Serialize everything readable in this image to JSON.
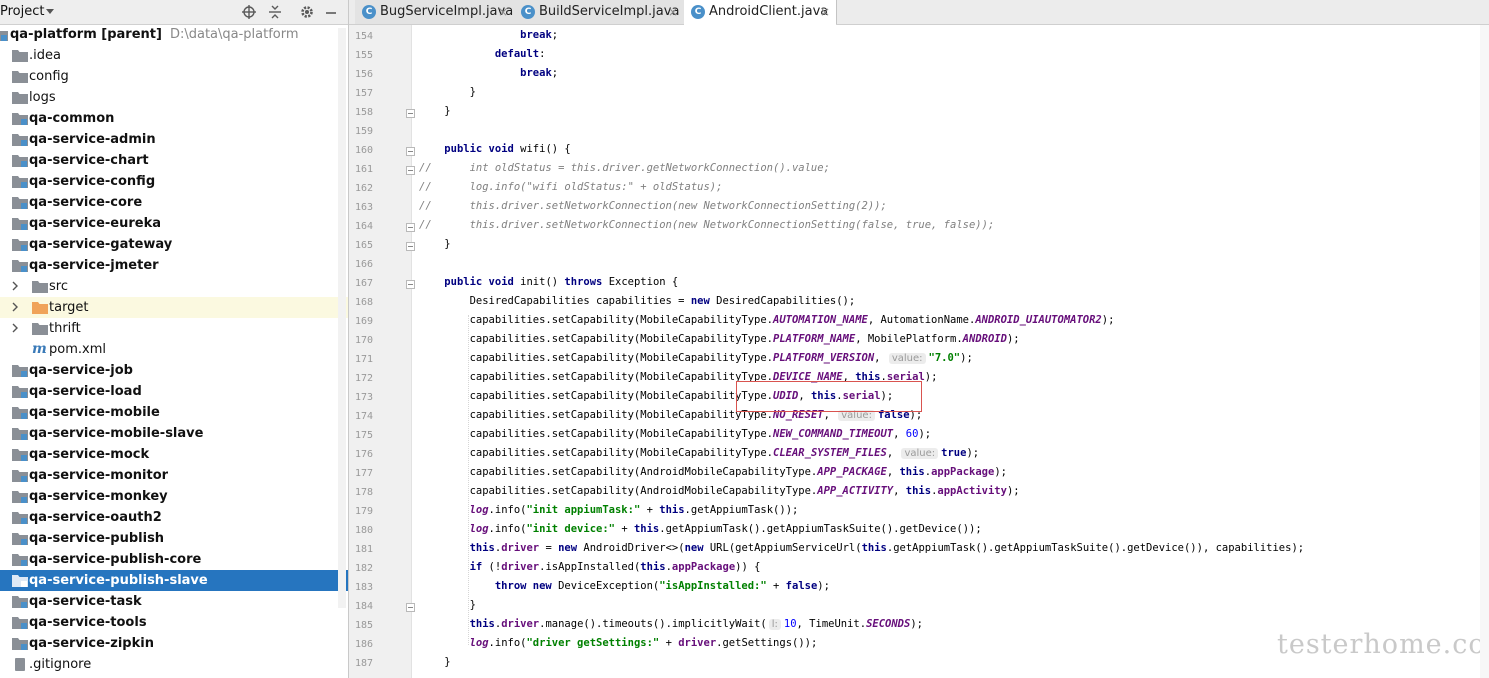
{
  "panel": {
    "title": "Project"
  },
  "tree": [
    {
      "label": "qa-platform [parent]",
      "path": "D:\\data\\qa-platform",
      "bold": true,
      "indent": 0,
      "icon": "module"
    },
    {
      "label": ".idea",
      "indent": 1,
      "icon": "folder"
    },
    {
      "label": "config",
      "indent": 1,
      "icon": "folder"
    },
    {
      "label": "logs",
      "indent": 1,
      "icon": "folder"
    },
    {
      "label": "qa-common",
      "bold": true,
      "indent": 1,
      "icon": "module"
    },
    {
      "label": "qa-service-admin",
      "bold": true,
      "indent": 1,
      "icon": "module"
    },
    {
      "label": "qa-service-chart",
      "bold": true,
      "indent": 1,
      "icon": "module"
    },
    {
      "label": "qa-service-config",
      "bold": true,
      "indent": 1,
      "icon": "module"
    },
    {
      "label": "qa-service-core",
      "bold": true,
      "indent": 1,
      "icon": "module"
    },
    {
      "label": "qa-service-eureka",
      "bold": true,
      "indent": 1,
      "icon": "module"
    },
    {
      "label": "qa-service-gateway",
      "bold": true,
      "indent": 1,
      "icon": "module"
    },
    {
      "label": "qa-service-jmeter",
      "bold": true,
      "indent": 1,
      "icon": "module",
      "expanded": true
    },
    {
      "label": "src",
      "indent": 2,
      "icon": "folder",
      "chevron": true
    },
    {
      "label": "target",
      "indent": 2,
      "icon": "folder-orange",
      "chevron": true,
      "excluded": true
    },
    {
      "label": "thrift",
      "indent": 2,
      "icon": "folder",
      "chevron": true
    },
    {
      "label": "pom.xml",
      "indent": 2,
      "icon": "pom"
    },
    {
      "label": "qa-service-job",
      "bold": true,
      "indent": 1,
      "icon": "module"
    },
    {
      "label": "qa-service-load",
      "bold": true,
      "indent": 1,
      "icon": "module"
    },
    {
      "label": "qa-service-mobile",
      "bold": true,
      "indent": 1,
      "icon": "module"
    },
    {
      "label": "qa-service-mobile-slave",
      "bold": true,
      "indent": 1,
      "icon": "module"
    },
    {
      "label": "qa-service-mock",
      "bold": true,
      "indent": 1,
      "icon": "module"
    },
    {
      "label": "qa-service-monitor",
      "bold": true,
      "indent": 1,
      "icon": "module"
    },
    {
      "label": "qa-service-monkey",
      "bold": true,
      "indent": 1,
      "icon": "module"
    },
    {
      "label": "qa-service-oauth2",
      "bold": true,
      "indent": 1,
      "icon": "module"
    },
    {
      "label": "qa-service-publish",
      "bold": true,
      "indent": 1,
      "icon": "module"
    },
    {
      "label": "qa-service-publish-core",
      "bold": true,
      "indent": 1,
      "icon": "module"
    },
    {
      "label": "qa-service-publish-slave",
      "bold": true,
      "indent": 1,
      "icon": "module",
      "selected": true
    },
    {
      "label": "qa-service-task",
      "bold": true,
      "indent": 1,
      "icon": "module"
    },
    {
      "label": "qa-service-tools",
      "bold": true,
      "indent": 1,
      "icon": "module"
    },
    {
      "label": "qa-service-zipkin",
      "bold": true,
      "indent": 1,
      "icon": "module"
    },
    {
      "label": ".gitignore",
      "indent": 1,
      "icon": "file"
    }
  ],
  "tabs": [
    {
      "label": "BugServiceImpl.java",
      "icon": "C",
      "active": false
    },
    {
      "label": "BuildServiceImpl.java",
      "icon": "C",
      "active": false
    },
    {
      "label": "AndroidClient.java",
      "icon": "C",
      "active": true
    }
  ],
  "close_glyph": "×",
  "lines": [
    {
      "n": "154",
      "tok": [
        [
          "                ",
          ""
        ],
        [
          "break",
          "kw"
        ],
        [
          ";",
          ""
        ]
      ]
    },
    {
      "n": "155",
      "tok": [
        [
          "            ",
          ""
        ],
        [
          "default",
          "kw"
        ],
        [
          ":",
          ""
        ]
      ]
    },
    {
      "n": "156",
      "tok": [
        [
          "                ",
          ""
        ],
        [
          "break",
          "kw"
        ],
        [
          ";",
          ""
        ]
      ]
    },
    {
      "n": "157",
      "tok": [
        [
          "        }",
          ""
        ]
      ]
    },
    {
      "n": "158",
      "tok": [
        [
          "    }",
          ""
        ]
      ]
    },
    {
      "n": "159",
      "tok": []
    },
    {
      "n": "160",
      "tok": [
        [
          "    ",
          ""
        ],
        [
          "public void ",
          "kw"
        ],
        [
          "wifi() {",
          ""
        ]
      ]
    },
    {
      "n": "161",
      "tok": [
        [
          "//      int oldStatus = this.driver.getNetworkConnection().value;",
          "cmt"
        ]
      ]
    },
    {
      "n": "162",
      "tok": [
        [
          "//      log.info(\"wifi oldStatus:\" + oldStatus);",
          "cmt"
        ]
      ]
    },
    {
      "n": "163",
      "tok": [
        [
          "//      this.driver.setNetworkConnection(new NetworkConnectionSetting(2));",
          "cmt"
        ]
      ]
    },
    {
      "n": "164",
      "tok": [
        [
          "//      this.driver.setNetworkConnection(new NetworkConnectionSetting(false, true, false));",
          "cmt"
        ]
      ]
    },
    {
      "n": "165",
      "tok": [
        [
          "    }",
          ""
        ]
      ]
    },
    {
      "n": "166",
      "tok": []
    },
    {
      "n": "167",
      "tok": [
        [
          "    ",
          ""
        ],
        [
          "public void ",
          "kw"
        ],
        [
          "init() ",
          ""
        ],
        [
          "throws ",
          "kw"
        ],
        [
          "Exception {",
          ""
        ]
      ]
    },
    {
      "n": "168",
      "tok": [
        [
          "        DesiredCapabilities capabilities = ",
          ""
        ],
        [
          "new ",
          "kw"
        ],
        [
          "DesiredCapabilities();",
          ""
        ]
      ]
    },
    {
      "n": "169",
      "tok": [
        [
          "        capabilities.setCapability(MobileCapabilityType.",
          ""
        ],
        [
          "AUTOMATION_NAME",
          "const"
        ],
        [
          ", AutomationName.",
          ""
        ],
        [
          "ANDROID_UIAUTOMATOR2",
          "const"
        ],
        [
          ");",
          ""
        ]
      ]
    },
    {
      "n": "170",
      "tok": [
        [
          "        capabilities.setCapability(MobileCapabilityType.",
          ""
        ],
        [
          "PLATFORM_NAME",
          "const"
        ],
        [
          ", MobilePlatform.",
          ""
        ],
        [
          "ANDROID",
          "const"
        ],
        [
          ");",
          ""
        ]
      ]
    },
    {
      "n": "171",
      "tok": [
        [
          "        capabilities.setCapability(MobileCapabilityType.",
          ""
        ],
        [
          "PLATFORM_VERSION",
          "const"
        ],
        [
          ", ",
          ""
        ],
        [
          "value:",
          "hint"
        ],
        [
          "\"7.0\"",
          "str"
        ],
        [
          ");",
          ""
        ]
      ]
    },
    {
      "n": "172",
      "tok": [
        [
          "        capabilities.setCapability(MobileCapabilityType.",
          ""
        ],
        [
          "DEVICE_NAME",
          "const"
        ],
        [
          ", ",
          ""
        ],
        [
          "this",
          "kw"
        ],
        [
          ".",
          ""
        ],
        [
          "serial",
          "fld"
        ],
        [
          ");",
          ""
        ]
      ]
    },
    {
      "n": "173",
      "tok": [
        [
          "        capabilities.setCapability(MobileCapabilityType.",
          ""
        ],
        [
          "UDID",
          "const"
        ],
        [
          ", ",
          ""
        ],
        [
          "this",
          "kw"
        ],
        [
          ".",
          ""
        ],
        [
          "serial",
          "fld"
        ],
        [
          ");",
          ""
        ]
      ]
    },
    {
      "n": "174",
      "tok": [
        [
          "        capabilities.setCapability(MobileCapabilityType.",
          ""
        ],
        [
          "NO_RESET",
          "const"
        ],
        [
          ", ",
          ""
        ],
        [
          "value:",
          "hint"
        ],
        [
          "false",
          "kw"
        ],
        [
          ");",
          ""
        ]
      ]
    },
    {
      "n": "175",
      "tok": [
        [
          "        capabilities.setCapability(MobileCapabilityType.",
          ""
        ],
        [
          "NEW_COMMAND_TIMEOUT",
          "const"
        ],
        [
          ", ",
          ""
        ],
        [
          "60",
          "num"
        ],
        [
          ");",
          ""
        ]
      ]
    },
    {
      "n": "176",
      "tok": [
        [
          "        capabilities.setCapability(MobileCapabilityType.",
          ""
        ],
        [
          "CLEAR_SYSTEM_FILES",
          "const"
        ],
        [
          ", ",
          ""
        ],
        [
          "value:",
          "hint"
        ],
        [
          "true",
          "kw"
        ],
        [
          ");",
          ""
        ]
      ]
    },
    {
      "n": "177",
      "tok": [
        [
          "        capabilities.setCapability(AndroidMobileCapabilityType.",
          ""
        ],
        [
          "APP_PACKAGE",
          "const"
        ],
        [
          ", ",
          ""
        ],
        [
          "this",
          "kw"
        ],
        [
          ".",
          ""
        ],
        [
          "appPackage",
          "fld"
        ],
        [
          ");",
          ""
        ]
      ]
    },
    {
      "n": "178",
      "tok": [
        [
          "        capabilities.setCapability(AndroidMobileCapabilityType.",
          ""
        ],
        [
          "APP_ACTIVITY",
          "const"
        ],
        [
          ", ",
          ""
        ],
        [
          "this",
          "kw"
        ],
        [
          ".",
          ""
        ],
        [
          "appActivity",
          "fld"
        ],
        [
          ");",
          ""
        ]
      ]
    },
    {
      "n": "179",
      "tok": [
        [
          "        ",
          ""
        ],
        [
          "log",
          "const"
        ],
        [
          ".info(",
          ""
        ],
        [
          "\"init appiumTask:\"",
          "str"
        ],
        [
          " + ",
          ""
        ],
        [
          "this",
          "kw"
        ],
        [
          ".getAppiumTask());",
          ""
        ]
      ]
    },
    {
      "n": "180",
      "tok": [
        [
          "        ",
          ""
        ],
        [
          "log",
          "const"
        ],
        [
          ".info(",
          ""
        ],
        [
          "\"init device:\"",
          "str"
        ],
        [
          " + ",
          ""
        ],
        [
          "this",
          "kw"
        ],
        [
          ".getAppiumTask().getAppiumTaskSuite().getDevice());",
          ""
        ]
      ]
    },
    {
      "n": "181",
      "tok": [
        [
          "        ",
          ""
        ],
        [
          "this",
          "kw"
        ],
        [
          ".",
          ""
        ],
        [
          "driver",
          "fld"
        ],
        [
          " = ",
          ""
        ],
        [
          "new ",
          "kw"
        ],
        [
          "AndroidDriver<>(",
          ""
        ],
        [
          "new ",
          "kw"
        ],
        [
          "URL(getAppiumServiceUrl(",
          ""
        ],
        [
          "this",
          "kw"
        ],
        [
          ".getAppiumTask().getAppiumTaskSuite().getDevice()), capabilities);",
          ""
        ]
      ]
    },
    {
      "n": "182",
      "tok": [
        [
          "        ",
          ""
        ],
        [
          "if ",
          "kw"
        ],
        [
          "(!",
          ""
        ],
        [
          "driver",
          "fld"
        ],
        [
          ".isAppInstalled(",
          ""
        ],
        [
          "this",
          "kw"
        ],
        [
          ".",
          ""
        ],
        [
          "appPackage",
          "fld"
        ],
        [
          ")) {",
          ""
        ]
      ]
    },
    {
      "n": "183",
      "tok": [
        [
          "            ",
          ""
        ],
        [
          "throw new ",
          "kw"
        ],
        [
          "DeviceException(",
          ""
        ],
        [
          "\"isAppInstalled:\"",
          "str"
        ],
        [
          " + ",
          ""
        ],
        [
          "false",
          "kw"
        ],
        [
          ");",
          ""
        ]
      ]
    },
    {
      "n": "184",
      "tok": [
        [
          "        }",
          ""
        ]
      ]
    },
    {
      "n": "185",
      "tok": [
        [
          "        ",
          ""
        ],
        [
          "this",
          "kw"
        ],
        [
          ".",
          ""
        ],
        [
          "driver",
          "fld"
        ],
        [
          ".manage().timeouts().implicitlyWait(",
          ""
        ],
        [
          "l:",
          "hint"
        ],
        [
          "10",
          "num"
        ],
        [
          ", TimeUnit.",
          ""
        ],
        [
          "SECONDS",
          "const"
        ],
        [
          ");",
          ""
        ]
      ]
    },
    {
      "n": "186",
      "tok": [
        [
          "        ",
          ""
        ],
        [
          "log",
          "const"
        ],
        [
          ".info(",
          ""
        ],
        [
          "\"driver getSettings:\"",
          "str"
        ],
        [
          " + ",
          ""
        ],
        [
          "driver",
          "fld"
        ],
        [
          ".getSettings());",
          ""
        ]
      ]
    },
    {
      "n": "187",
      "tok": [
        [
          "    }",
          ""
        ]
      ]
    }
  ],
  "watermark": "testerhome.com",
  "colors": {
    "selection": "#2675bf",
    "keyword": "#000080",
    "string": "#008000",
    "constant": "#660e7a",
    "highlight_box": "#d9534f"
  }
}
